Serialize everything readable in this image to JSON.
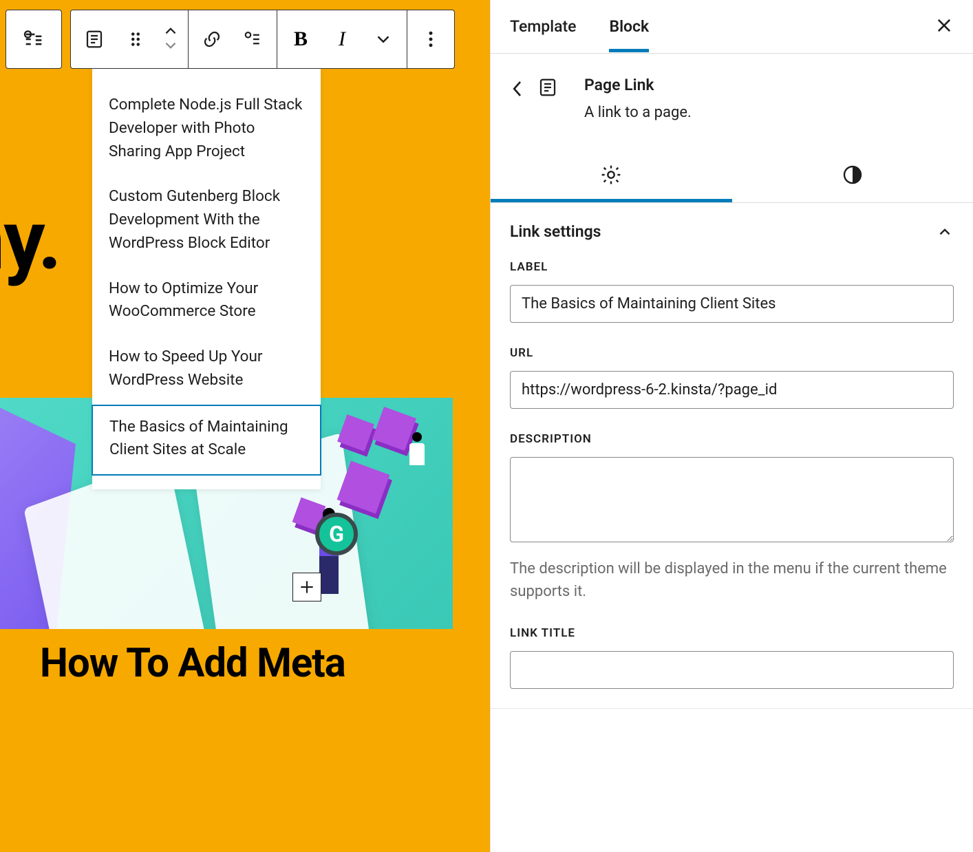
{
  "canvas": {
    "bg_text_fragment": "hy.",
    "bg_heading": "How To Add Meta"
  },
  "toolbar": {
    "block_type": "submenu",
    "buttons": {
      "transform": "page-link-icon",
      "drag": "drag-handle",
      "move_up": "move-up",
      "move_down": "move-down",
      "link": "link",
      "submenu": "submenu",
      "bold": "B",
      "italic": "I",
      "more_format": "chevron-down",
      "options": "more"
    }
  },
  "submenu": {
    "items": [
      {
        "label": "Complete Node.js Full Stack Developer with Photo Sharing App Project",
        "selected": false
      },
      {
        "label": "Custom Gutenberg Block Development With the WordPress Block Editor",
        "selected": false
      },
      {
        "label": "How to Optimize Your WooCommerce Store",
        "selected": false
      },
      {
        "label": "How to Speed Up Your WordPress Website",
        "selected": false
      },
      {
        "label": "The Basics of Maintaining Client Sites at Scale",
        "selected": true
      }
    ],
    "grammarly_glyph": "G"
  },
  "sidebar": {
    "tabs": [
      {
        "label": "Template",
        "active": false
      },
      {
        "label": "Block",
        "active": true
      }
    ],
    "crumb": {
      "title": "Page Link",
      "desc": "A link to a page."
    },
    "section_title": "Link settings",
    "fields": {
      "label": {
        "caption": "LABEL",
        "value": "The Basics of Maintaining Client Sites"
      },
      "url": {
        "caption": "URL",
        "value": "https://wordpress-6-2.kinsta/?page_id"
      },
      "description": {
        "caption": "DESCRIPTION",
        "value": "",
        "hint": "The description will be displayed in the menu if the current theme supports it."
      },
      "link_title": {
        "caption": "LINK TITLE",
        "value": ""
      }
    }
  }
}
